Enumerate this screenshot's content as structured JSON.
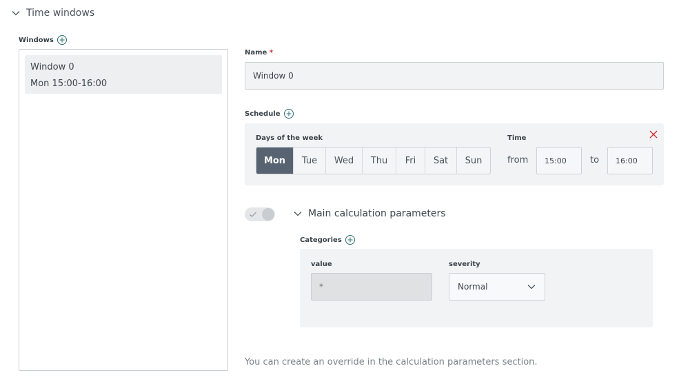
{
  "section": {
    "title": "Time windows"
  },
  "windows": {
    "label": "Windows",
    "items": [
      {
        "name": "Window 0",
        "summary": "Mon 15:00-16:00"
      }
    ]
  },
  "name_field": {
    "label": "Name",
    "required_mark": "*",
    "value": "Window 0"
  },
  "schedule": {
    "label": "Schedule",
    "days_label": "Days of the week",
    "days": [
      "Mon",
      "Tue",
      "Wed",
      "Thu",
      "Fri",
      "Sat",
      "Sun"
    ],
    "selected_day": "Mon",
    "time_label": "Time",
    "from_label": "from",
    "to_label": "to",
    "from_value": "15:00",
    "to_value": "16:00"
  },
  "main_params": {
    "title": "Main calculation parameters",
    "toggle_on": false
  },
  "categories": {
    "label": "Categories",
    "value_label": "value",
    "value_placeholder": "*",
    "severity_label": "severity",
    "severity_value": "Normal"
  },
  "hint": "You can create an override in the calculation parameters section.",
  "colors": {
    "active_day_bg": "#576370",
    "close_icon": "#d02b2b",
    "accent": "#2f6f74"
  }
}
